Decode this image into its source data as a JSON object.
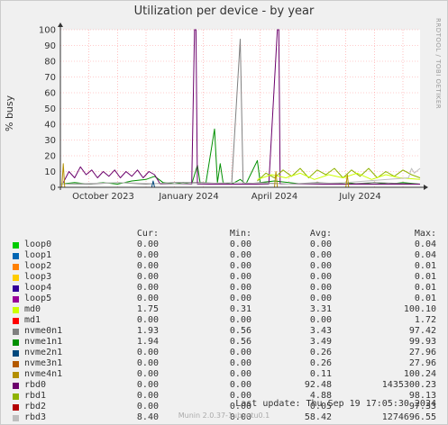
{
  "page": {
    "title": "Utilization per device - by year",
    "side_label": "RRDTOOL / TOBI OETIKER",
    "last_update": "Last update: Thu Sep 19 17:05:30 2024",
    "munin_version": "Munin 2.0.37-1ubuntu0.1"
  },
  "legend": {
    "headers": {
      "cur": "Cur:",
      "min": "Min:",
      "avg": "Avg:",
      "max": "Max:"
    },
    "rows": [
      {
        "name": "loop0",
        "color": "#00cc00",
        "cur": "0.00",
        "min": "0.00",
        "avg": "0.00",
        "max": "0.04"
      },
      {
        "name": "loop1",
        "color": "#0066b3",
        "cur": "0.00",
        "min": "0.00",
        "avg": "0.00",
        "max": "0.04"
      },
      {
        "name": "loop2",
        "color": "#ff8000",
        "cur": "0.00",
        "min": "0.00",
        "avg": "0.00",
        "max": "0.01"
      },
      {
        "name": "loop3",
        "color": "#ffcc00",
        "cur": "0.00",
        "min": "0.00",
        "avg": "0.00",
        "max": "0.01"
      },
      {
        "name": "loop4",
        "color": "#330099",
        "cur": "0.00",
        "min": "0.00",
        "avg": "0.00",
        "max": "0.01"
      },
      {
        "name": "loop5",
        "color": "#990099",
        "cur": "0.00",
        "min": "0.00",
        "avg": "0.00",
        "max": "0.01"
      },
      {
        "name": "md0",
        "color": "#ccff00",
        "cur": "1.75",
        "min": "0.31",
        "avg": "3.31",
        "max": "100.10"
      },
      {
        "name": "md1",
        "color": "#ff0000",
        "cur": "0.00",
        "min": "0.00",
        "avg": "0.00",
        "max": "1.72"
      },
      {
        "name": "nvme0n1",
        "color": "#808080",
        "cur": "1.93",
        "min": "0.56",
        "avg": "3.43",
        "max": "97.42"
      },
      {
        "name": "nvme1n1",
        "color": "#008f00",
        "cur": "1.94",
        "min": "0.56",
        "avg": "3.49",
        "max": "99.93"
      },
      {
        "name": "nvme2n1",
        "color": "#00487d",
        "cur": "0.00",
        "min": "0.00",
        "avg": "0.26",
        "max": "27.96"
      },
      {
        "name": "nvme3n1",
        "color": "#b35a00",
        "cur": "0.00",
        "min": "0.00",
        "avg": "0.26",
        "max": "27.96"
      },
      {
        "name": "nvme4n1",
        "color": "#b38f00",
        "cur": "0.00",
        "min": "0.00",
        "avg": "0.11",
        "max": "100.24"
      },
      {
        "name": "rbd0",
        "color": "#6b006b",
        "cur": "0.00",
        "min": "0.00",
        "avg": "92.48",
        "max": "1435300.23"
      },
      {
        "name": "rbd1",
        "color": "#8fb300",
        "cur": "0.00",
        "min": "0.00",
        "avg": "4.88",
        "max": "98.13"
      },
      {
        "name": "rbd2",
        "color": "#b30000",
        "cur": "0.00",
        "min": "0.00",
        "avg": "0.05",
        "max": "97.33"
      },
      {
        "name": "rbd3",
        "color": "#bebebe",
        "cur": "8.40",
        "min": "0.00",
        "avg": "58.42",
        "max": "1274696.55"
      }
    ]
  },
  "chart_data": {
    "type": "line",
    "title": "Utilization per device - by year",
    "ylabel": "% busy",
    "ylim": [
      0,
      100
    ],
    "yticks": [
      0,
      10,
      20,
      30,
      40,
      50,
      60,
      70,
      80,
      90,
      100
    ],
    "xticks": [
      "October 2023",
      "January 2024",
      "April 2024",
      "July 2024"
    ],
    "xrange_months": [
      0,
      12.6
    ],
    "xtick_positions_months": [
      1.5,
      4.5,
      7.5,
      10.5
    ],
    "grid": true,
    "series": [
      {
        "name": "nvme1n1",
        "color": "#008f00",
        "points": [
          [
            0.0,
            2
          ],
          [
            0.5,
            3
          ],
          [
            1.0,
            2
          ],
          [
            1.5,
            3
          ],
          [
            2.0,
            2
          ],
          [
            2.5,
            4
          ],
          [
            3.0,
            5
          ],
          [
            3.3,
            7
          ],
          [
            3.6,
            3
          ],
          [
            4.0,
            2
          ],
          [
            4.3,
            3
          ],
          [
            4.6,
            2
          ],
          [
            4.8,
            14
          ],
          [
            4.9,
            2
          ],
          [
            5.1,
            3
          ],
          [
            5.4,
            37
          ],
          [
            5.5,
            3
          ],
          [
            5.6,
            15
          ],
          [
            5.7,
            3
          ],
          [
            6.0,
            2
          ],
          [
            6.3,
            5
          ],
          [
            6.5,
            2
          ],
          [
            6.9,
            17
          ],
          [
            7.0,
            3
          ],
          [
            7.5,
            4
          ],
          [
            8.0,
            3
          ],
          [
            8.5,
            2
          ],
          [
            9.0,
            3
          ],
          [
            9.5,
            2
          ],
          [
            10.0,
            3
          ],
          [
            10.5,
            2
          ],
          [
            11.0,
            3
          ],
          [
            11.5,
            2
          ],
          [
            12.0,
            3
          ],
          [
            12.6,
            2
          ]
        ]
      },
      {
        "name": "nvme0n1",
        "color": "#808080",
        "points": [
          [
            0.0,
            2
          ],
          [
            1.0,
            2
          ],
          [
            2.0,
            3
          ],
          [
            3.0,
            2
          ],
          [
            4.0,
            3
          ],
          [
            5.0,
            3
          ],
          [
            6.0,
            2
          ],
          [
            6.3,
            94
          ],
          [
            6.4,
            2
          ],
          [
            7.0,
            3
          ],
          [
            8.0,
            2
          ],
          [
            9.0,
            3
          ],
          [
            10.0,
            2
          ],
          [
            11.0,
            3
          ],
          [
            12.6,
            2
          ]
        ]
      },
      {
        "name": "rbd0",
        "color": "#6b006b",
        "points": [
          [
            0.1,
            3
          ],
          [
            0.3,
            10
          ],
          [
            0.5,
            6
          ],
          [
            0.7,
            13
          ],
          [
            0.9,
            8
          ],
          [
            1.1,
            11
          ],
          [
            1.3,
            6
          ],
          [
            1.5,
            10
          ],
          [
            1.7,
            7
          ],
          [
            1.9,
            11
          ],
          [
            2.1,
            6
          ],
          [
            2.3,
            10
          ],
          [
            2.5,
            7
          ],
          [
            2.7,
            11
          ],
          [
            2.9,
            6
          ],
          [
            3.1,
            10
          ],
          [
            3.3,
            8
          ],
          [
            3.5,
            2
          ],
          [
            4.0,
            2
          ],
          [
            4.6,
            2
          ],
          [
            4.7,
            100
          ],
          [
            4.75,
            100
          ],
          [
            4.8,
            2
          ],
          [
            5.5,
            2
          ],
          [
            6.5,
            2
          ],
          [
            7.3,
            2
          ],
          [
            7.6,
            100
          ],
          [
            7.65,
            100
          ],
          [
            7.7,
            2
          ],
          [
            8.5,
            2
          ],
          [
            9.5,
            2
          ],
          [
            10.5,
            2
          ],
          [
            12.6,
            2
          ]
        ]
      },
      {
        "name": "rbd1",
        "color": "#8fb300",
        "points": [
          [
            6.9,
            4
          ],
          [
            7.2,
            9
          ],
          [
            7.5,
            6
          ],
          [
            7.8,
            11
          ],
          [
            8.1,
            7
          ],
          [
            8.4,
            12
          ],
          [
            8.7,
            6
          ],
          [
            9.0,
            11
          ],
          [
            9.3,
            8
          ],
          [
            9.6,
            12
          ],
          [
            9.9,
            6
          ],
          [
            10.2,
            11
          ],
          [
            10.5,
            7
          ],
          [
            10.8,
            12
          ],
          [
            11.1,
            6
          ],
          [
            11.4,
            10
          ],
          [
            11.7,
            7
          ],
          [
            12.0,
            11
          ],
          [
            12.3,
            8
          ],
          [
            12.6,
            6
          ]
        ]
      },
      {
        "name": "md0",
        "color": "#ccff00",
        "points": [
          [
            6.9,
            5
          ],
          [
            7.4,
            8
          ],
          [
            7.9,
            6
          ],
          [
            8.4,
            9
          ],
          [
            8.9,
            5
          ],
          [
            9.4,
            8
          ],
          [
            9.9,
            6
          ],
          [
            10.4,
            9
          ],
          [
            10.9,
            5
          ],
          [
            11.4,
            8
          ],
          [
            11.9,
            6
          ],
          [
            12.6,
            5
          ]
        ]
      },
      {
        "name": "rbd3",
        "color": "#bebebe",
        "points": [
          [
            0.0,
            2
          ],
          [
            2.0,
            3
          ],
          [
            4.0,
            2
          ],
          [
            6.0,
            3
          ],
          [
            8.0,
            2
          ],
          [
            10.0,
            3
          ],
          [
            12.2,
            6
          ],
          [
            12.3,
            12
          ],
          [
            12.4,
            9
          ],
          [
            12.6,
            12
          ]
        ]
      },
      {
        "name": "nvme4n1",
        "color": "#b38f00",
        "points": [
          [
            0.05,
            0
          ],
          [
            0.1,
            15
          ],
          [
            0.15,
            0
          ],
          [
            7.5,
            0
          ],
          [
            7.55,
            10
          ],
          [
            7.6,
            0
          ],
          [
            10.0,
            0
          ],
          [
            10.05,
            8
          ],
          [
            10.1,
            0
          ]
        ]
      },
      {
        "name": "nvme2n1",
        "color": "#00487d",
        "points": [
          [
            0.0,
            0
          ],
          [
            3.2,
            0
          ],
          [
            3.25,
            4
          ],
          [
            3.3,
            0
          ],
          [
            12.6,
            0
          ]
        ]
      }
    ]
  }
}
